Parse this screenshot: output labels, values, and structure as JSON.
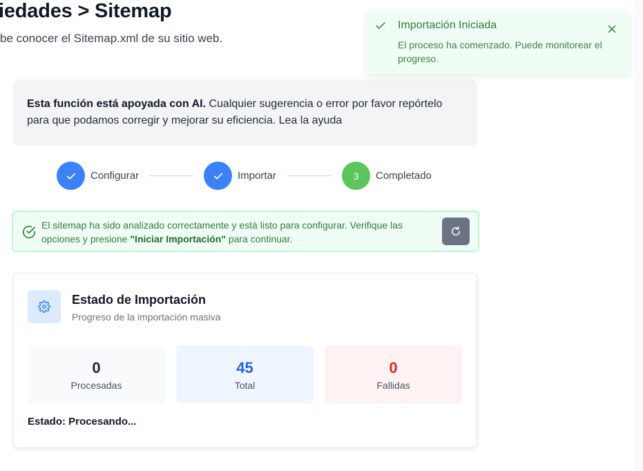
{
  "header": {
    "title": "iedades > Sitemap",
    "subtitle": "be conocer el Sitemap.xml de su sitio web."
  },
  "ai_notice": {
    "bold": "Esta función está apoyada con AI.",
    "text": " Cualquier sugerencia o error por favor repórtelo para que podamos corregir y mejorar su eficiencia.",
    "link": " Lea la ayuda"
  },
  "stepper": {
    "steps": [
      {
        "label": "Configurar",
        "state": "done"
      },
      {
        "label": "Importar",
        "state": "done"
      },
      {
        "label": "Completado",
        "state": "current",
        "number": "3"
      }
    ]
  },
  "alert": {
    "text_before": "El sitemap ha sido analizado correctamente y está listo para configurar. Verifique las opciones y presione ",
    "highlight": "\"Iniciar Importación\"",
    "text_after": " para continuar.",
    "refresh_icon": "refresh-icon"
  },
  "import_card": {
    "icon": "gear-icon",
    "title": "Estado de Importación",
    "subtitle": "Progreso de la importación masiva",
    "stats": {
      "processed": {
        "value": "0",
        "label": "Procesadas"
      },
      "total": {
        "value": "45",
        "label": "Total"
      },
      "failed": {
        "value": "0",
        "label": "Fallidas"
      }
    },
    "status": "Estado: Procesando..."
  },
  "toast": {
    "title": "Importación Iniciada",
    "body": "El proceso ha comenzado. Puede monitorear el progreso."
  },
  "colors": {
    "step_blue": "#3b82f6",
    "step_green": "#5cc65d",
    "success_text": "#2f7d3d",
    "total_blue": "#2563eb",
    "failed_red": "#dc2626"
  }
}
